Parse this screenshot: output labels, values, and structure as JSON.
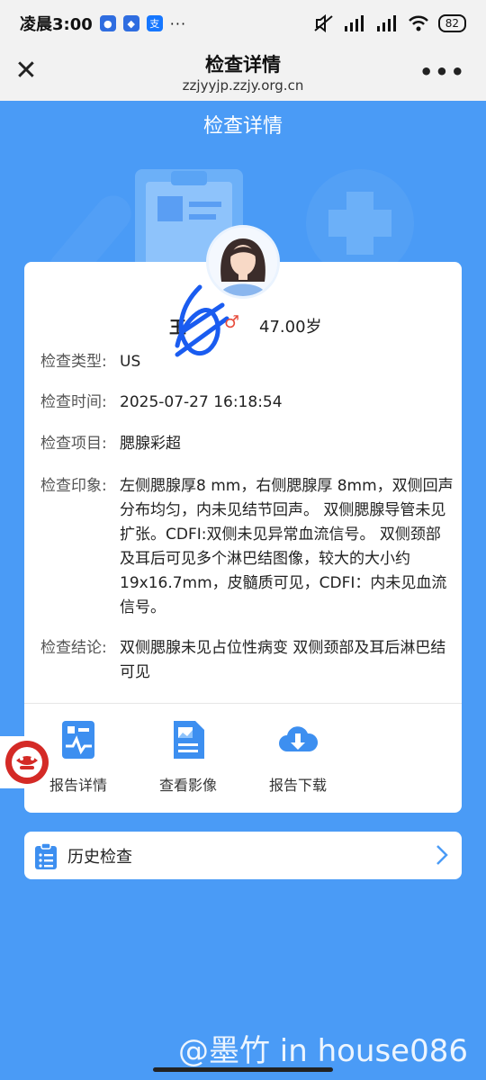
{
  "status": {
    "time": "凌晨3:00",
    "battery": "82"
  },
  "nav": {
    "title": "检查详情",
    "url": "zzjyyjp.zzjy.org.cn"
  },
  "page_title": "检查详情",
  "patient": {
    "name": "王",
    "gender": "♂",
    "age": "47.00岁"
  },
  "fields": [
    {
      "label": "检查类型:",
      "value": "US"
    },
    {
      "label": "检查时间:",
      "value": "2025-07-27 16:18:54"
    },
    {
      "label": "检查项目:",
      "value": "腮腺彩超"
    },
    {
      "label": "检查印象:",
      "value": "左侧腮腺厚8 mm，右侧腮腺厚 8mm，双侧回声分布均匀，内未见结节回声。 双侧腮腺导管未见扩张。CDFI:双侧未见异常血流信号。 双侧颈部及耳后可见多个淋巴结图像，较大的大小约19x16.7mm，皮髓质可见，CDFI：内未见血流信号。"
    },
    {
      "label": "检查结论:",
      "value": "双侧腮腺未见占位性病变 双侧颈部及耳后淋巴结可见"
    }
  ],
  "actions": [
    {
      "label": "报告详情",
      "icon": "report-detail-icon"
    },
    {
      "label": "查看影像",
      "icon": "view-image-icon"
    },
    {
      "label": "报告下载",
      "icon": "cloud-download-icon"
    }
  ],
  "history": {
    "label": "历史检查"
  },
  "watermark": "@墨竹 in house086",
  "colors": {
    "primary": "#4a9bf6",
    "accent": "#3d8ff0"
  }
}
